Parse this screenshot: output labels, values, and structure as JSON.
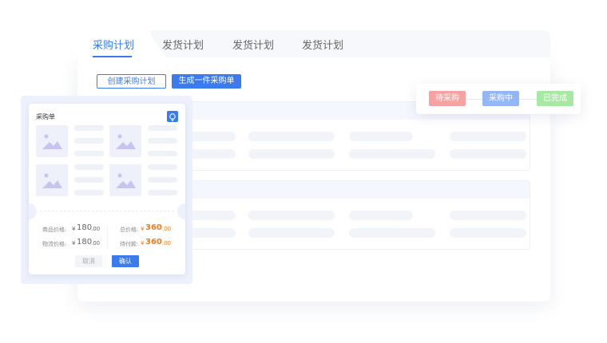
{
  "tabs": [
    {
      "label": "采购计划",
      "active": true
    },
    {
      "label": "发货计划"
    },
    {
      "label": "发货计划"
    },
    {
      "label": "发货计划"
    }
  ],
  "actions": {
    "create_label": "创建采购计划",
    "generate_label": "生成一件采购单"
  },
  "statuses": [
    {
      "label": "待采购",
      "color": "#f7a1a1"
    },
    {
      "label": "采购中",
      "color": "#94b6f7"
    },
    {
      "label": "已完成",
      "color": "#a7e9a3"
    }
  ],
  "order_card": {
    "title": "采购单",
    "icon": "lightbulb-icon",
    "goods_price_label": "商品价格:",
    "goods_price_currency": "¥",
    "goods_price_int": "180",
    "goods_price_dec": ".00",
    "shipping_price_label": "物流价格:",
    "shipping_price_currency": "¥",
    "shipping_price_int": "180",
    "shipping_price_dec": ".00",
    "total_label": "总价格:",
    "total_currency": "¥",
    "total_int": "360",
    "total_dec": ".00",
    "due_label": "待付款:",
    "due_currency": "¥",
    "due_int": "360",
    "due_dec": ".00",
    "cancel_label": "取消",
    "confirm_label": "确认"
  },
  "colors": {
    "primary": "#3a7bf0",
    "price_highlight": "#f07a1a"
  }
}
